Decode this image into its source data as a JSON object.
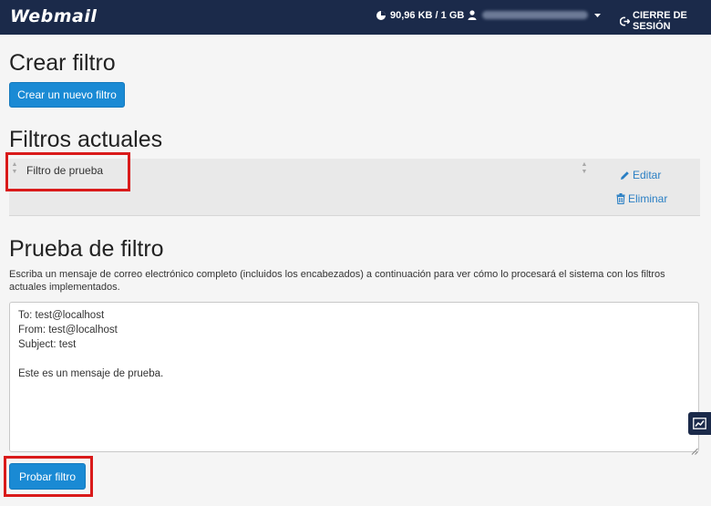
{
  "header": {
    "logo": "Webmail",
    "quota": "90,96 KB / 1 GB",
    "logout": "CIERRE DE SESIÓN"
  },
  "create": {
    "title": "Crear filtro",
    "new_button": "Crear un nuevo filtro"
  },
  "filters": {
    "title": "Filtros actuales",
    "items": [
      {
        "name": "Filtro de prueba",
        "edit": "Editar",
        "delete": "Eliminar"
      }
    ]
  },
  "test": {
    "title": "Prueba de filtro",
    "description": "Escriba un mensaje de correo electrónico completo (incluidos los encabezados) a continuación para ver cómo lo procesará el sistema con los filtros actuales implementados.",
    "message": "To: test@localhost\nFrom: test@localhost\nSubject: test\n\nEste es un mensaje de prueba.",
    "button": "Probar filtro"
  },
  "colors": {
    "topbar": "#1b2a4a",
    "primary_button": "#1a8ad4",
    "link": "#2a7fc4",
    "highlight": "#d91a1a"
  }
}
